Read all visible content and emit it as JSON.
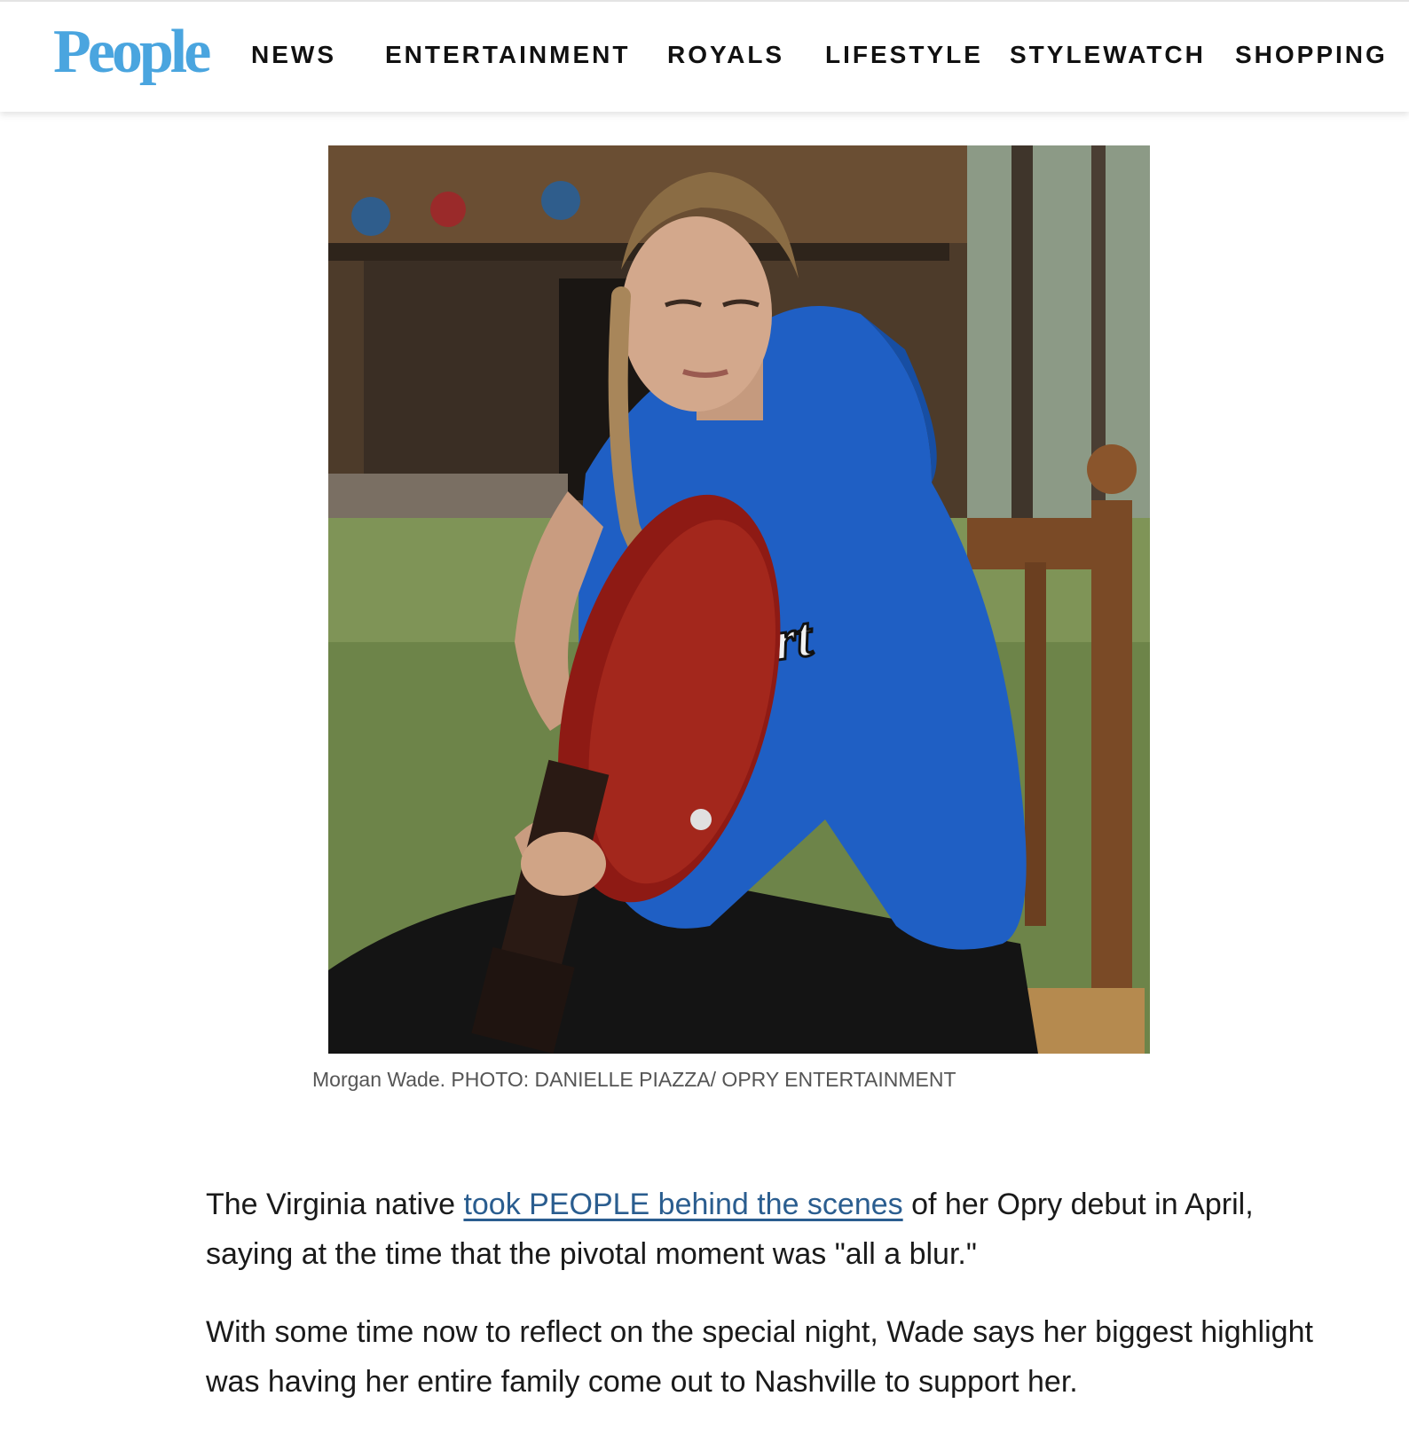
{
  "header": {
    "logo": "People",
    "nav": [
      "NEWS",
      "ENTERTAINMENT",
      "ROYALS",
      "LIFESTYLE",
      "STYLEWATCH",
      "SHOPPING"
    ]
  },
  "figure": {
    "caption": "Morgan Wade. PHOTO: DANIELLE PIAZZA/ OPRY ENTERTAINMENT",
    "alt": "Morgan Wade seated on a wooden chair playing a red acoustic guitar, wearing a blue hoodie, in front of a log cabin"
  },
  "article": {
    "p1_before": "The Virginia native ",
    "p1_link": "took PEOPLE behind the scenes",
    "p1_after": " of her Opry debut in April, saying at the time that the pivotal moment was \"all a blur.\"",
    "p2": "With some time now to reflect on the special night, Wade says her biggest highlight was having her entire family come out to Nashville to support her."
  },
  "colors": {
    "logo": "#4aa5df",
    "link": "#2a5d8f",
    "hoodie": "#1f5fc4",
    "guitar": "#8e1a14"
  }
}
